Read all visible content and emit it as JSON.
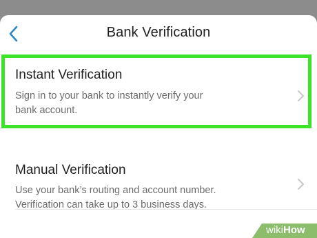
{
  "nav": {
    "title": "Bank Verification",
    "back_icon": "chevron-left-icon",
    "accent": "#2f86c9"
  },
  "options": [
    {
      "title": "Instant Verification",
      "description_lines": [
        "Sign in to your bank to instantly verify your",
        "bank account."
      ],
      "highlight_color": "#3ce328"
    },
    {
      "title": "Manual Verification",
      "description_lines": [
        "Use your bank’s routing and account number.",
        "Verification can take up to 3 business days."
      ]
    }
  ],
  "watermark": {
    "brand_logo": "wikiHow",
    "color": "#8bbd6b"
  }
}
